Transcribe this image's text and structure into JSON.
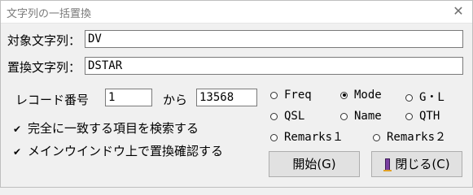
{
  "window": {
    "title": "文字列の一括置換",
    "close_glyph": "✕"
  },
  "target": {
    "label": "対象文字列：",
    "value": "DV"
  },
  "replace": {
    "label": "置換文字列：",
    "value": "DSTAR"
  },
  "record": {
    "label": "レコード番号",
    "from_value": "1",
    "kara": "から",
    "to_value": "13568"
  },
  "fields": [
    {
      "label": "Freq",
      "selected": false
    },
    {
      "label": "Mode",
      "selected": true
    },
    {
      "label": "G・L",
      "selected": false
    },
    {
      "label": "QSL",
      "selected": false
    },
    {
      "label": "Name",
      "selected": false
    },
    {
      "label": "QTH",
      "selected": false
    },
    {
      "label": "Remarks１",
      "selected": false
    },
    {
      "label": "Remarks２",
      "selected": false
    }
  ],
  "options": {
    "exact_match": {
      "label": "完全に一致する項目を検索する",
      "checked": true,
      "mark": "✔"
    },
    "confirm_main": {
      "label": "メインウインドウ上で置換確認する",
      "checked": true,
      "mark": "✔"
    }
  },
  "buttons": {
    "start": "開始(G)",
    "close": "閉じる(C)"
  }
}
